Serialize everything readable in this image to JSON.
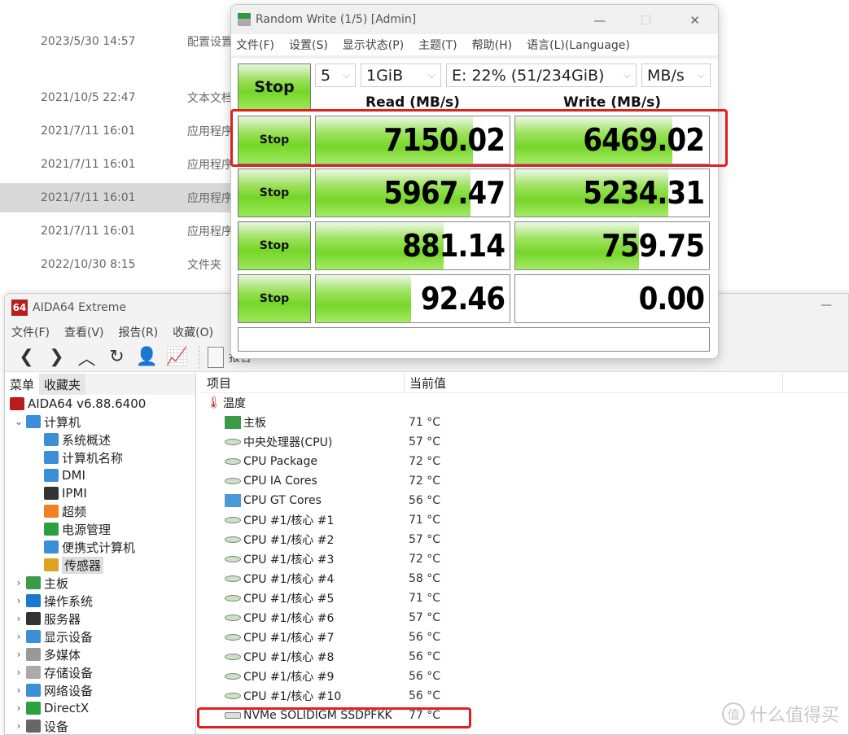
{
  "background_explorer": {
    "rows": [
      {
        "date": "2023/5/30 14:57",
        "type": "配置设置"
      },
      {
        "date": "2021/10/5 22:47",
        "type": "文本文档"
      },
      {
        "date": "2021/7/11 16:01",
        "type": "应用程序"
      },
      {
        "date": "2021/7/11 16:01",
        "type": "应用程序"
      },
      {
        "date": "2021/7/11 16:01",
        "type": "应用程序",
        "selected": true
      },
      {
        "date": "2021/7/11 16:01",
        "type": "应用程序"
      },
      {
        "date": "2022/10/30 8:15",
        "type": "文件夹"
      }
    ]
  },
  "cdm": {
    "title": "Random Write (1/5) [Admin]",
    "menu": [
      "文件(F)",
      "设置(S)",
      "显示状态(P)",
      "主题(T)",
      "帮助(H)",
      "语言(L)(Language)"
    ],
    "main_button": "Stop",
    "count": "5",
    "size": "1GiB",
    "drive": "E: 22% (51/234GiB)",
    "unit": "MB/s",
    "read_header": "Read (MB/s)",
    "write_header": "Write (MB/s)",
    "rows": [
      {
        "button": "Stop",
        "read": "7150.02",
        "write": "6469.02",
        "read_fill": 0.81,
        "write_fill": 0.81
      },
      {
        "button": "Stop",
        "read": "5967.47",
        "write": "5234.31",
        "read_fill": 0.8,
        "write_fill": 0.79
      },
      {
        "button": "Stop",
        "read": "881.14",
        "write": "759.75",
        "read_fill": 0.66,
        "write_fill": 0.64
      },
      {
        "button": "Stop",
        "read": "92.46",
        "write": "0.00",
        "read_fill": 0.49,
        "write_fill": 0.0
      }
    ],
    "status": ""
  },
  "aida": {
    "title": "AIDA64 Extreme",
    "logo": "64",
    "menu": [
      "文件(F)",
      "查看(V)",
      "报告(R)",
      "收藏(O)"
    ],
    "toolbar": [
      "back",
      "forward",
      "up",
      "refresh",
      "user",
      "chart"
    ],
    "report_label": "报告",
    "tabs": [
      "菜单",
      "收藏夹"
    ],
    "tree": [
      {
        "label": "AIDA64 v6.88.6400",
        "level": 0,
        "icon": "aida-logo-icon",
        "color": "#b81c1c"
      },
      {
        "label": "计算机",
        "level": 1,
        "expanded": true,
        "icon": "computer-icon",
        "color": "#3a8fd6"
      },
      {
        "label": "系统概述",
        "level": 2,
        "icon": "computer-icon",
        "color": "#3a8fd6"
      },
      {
        "label": "计算机名称",
        "level": 2,
        "icon": "computer-icon",
        "color": "#3a8fd6"
      },
      {
        "label": "DMI",
        "level": 2,
        "icon": "computer-icon",
        "color": "#3a8fd6"
      },
      {
        "label": "IPMI",
        "level": 2,
        "icon": "server-icon",
        "color": "#333"
      },
      {
        "label": "超频",
        "level": 2,
        "icon": "flame-icon",
        "color": "#f08020"
      },
      {
        "label": "电源管理",
        "level": 2,
        "icon": "battery-icon",
        "color": "#2aa040"
      },
      {
        "label": "便携式计算机",
        "level": 2,
        "icon": "laptop-icon",
        "color": "#3a8fd6"
      },
      {
        "label": "传感器",
        "level": 2,
        "icon": "gauge-icon",
        "color": "#e0a020",
        "selected": true
      },
      {
        "label": "主板",
        "level": 1,
        "collapsed": true,
        "icon": "motherboard-icon",
        "color": "#3a9a4a"
      },
      {
        "label": "操作系统",
        "level": 1,
        "collapsed": true,
        "icon": "windows-icon",
        "color": "#1a78d0"
      },
      {
        "label": "服务器",
        "level": 1,
        "collapsed": true,
        "icon": "server-icon",
        "color": "#333"
      },
      {
        "label": "显示设备",
        "level": 1,
        "collapsed": true,
        "icon": "monitor-icon",
        "color": "#3a8fd6"
      },
      {
        "label": "多媒体",
        "level": 1,
        "collapsed": true,
        "icon": "speaker-icon",
        "color": "#999"
      },
      {
        "label": "存储设备",
        "level": 1,
        "collapsed": true,
        "icon": "storage-icon",
        "color": "#aaa"
      },
      {
        "label": "网络设备",
        "level": 1,
        "collapsed": true,
        "icon": "network-icon",
        "color": "#3a8fd6"
      },
      {
        "label": "DirectX",
        "level": 1,
        "collapsed": true,
        "icon": "xbox-icon",
        "color": "#2aa040"
      },
      {
        "label": "设备",
        "level": 1,
        "collapsed": true,
        "icon": "device-icon",
        "color": "#666"
      }
    ],
    "columns": [
      "项目",
      "当前值"
    ],
    "group": "温度",
    "sensors": [
      {
        "name": "主板",
        "value": "71 °C",
        "icon": "motherboard"
      },
      {
        "name": "中央处理器(CPU)",
        "value": "57 °C",
        "icon": "chip"
      },
      {
        "name": "CPU Package",
        "value": "72 °C",
        "icon": "chip"
      },
      {
        "name": "CPU IA Cores",
        "value": "72 °C",
        "icon": "chip"
      },
      {
        "name": "CPU GT Cores",
        "value": "56 °C",
        "icon": "gpu"
      },
      {
        "name": "CPU #1/核心 #1",
        "value": "71 °C",
        "icon": "chip"
      },
      {
        "name": "CPU #1/核心 #2",
        "value": "57 °C",
        "icon": "chip"
      },
      {
        "name": "CPU #1/核心 #3",
        "value": "72 °C",
        "icon": "chip"
      },
      {
        "name": "CPU #1/核心 #4",
        "value": "58 °C",
        "icon": "chip"
      },
      {
        "name": "CPU #1/核心 #5",
        "value": "71 °C",
        "icon": "chip"
      },
      {
        "name": "CPU #1/核心 #6",
        "value": "57 °C",
        "icon": "chip"
      },
      {
        "name": "CPU #1/核心 #7",
        "value": "56 °C",
        "icon": "chip"
      },
      {
        "name": "CPU #1/核心 #8",
        "value": "56 °C",
        "icon": "chip"
      },
      {
        "name": "CPU #1/核心 #9",
        "value": "56 °C",
        "icon": "chip"
      },
      {
        "name": "CPU #1/核心 #10",
        "value": "56 °C",
        "icon": "chip"
      },
      {
        "name": "NVMe SOLIDIGM SSDPFKK",
        "value": "77 °C",
        "icon": "drive"
      }
    ]
  },
  "watermark": {
    "badge": "值",
    "text": "什么值得买"
  },
  "colors": {
    "highlight": "#e02020",
    "bar_green": "#77d62a",
    "aida_red": "#b81c1c"
  }
}
